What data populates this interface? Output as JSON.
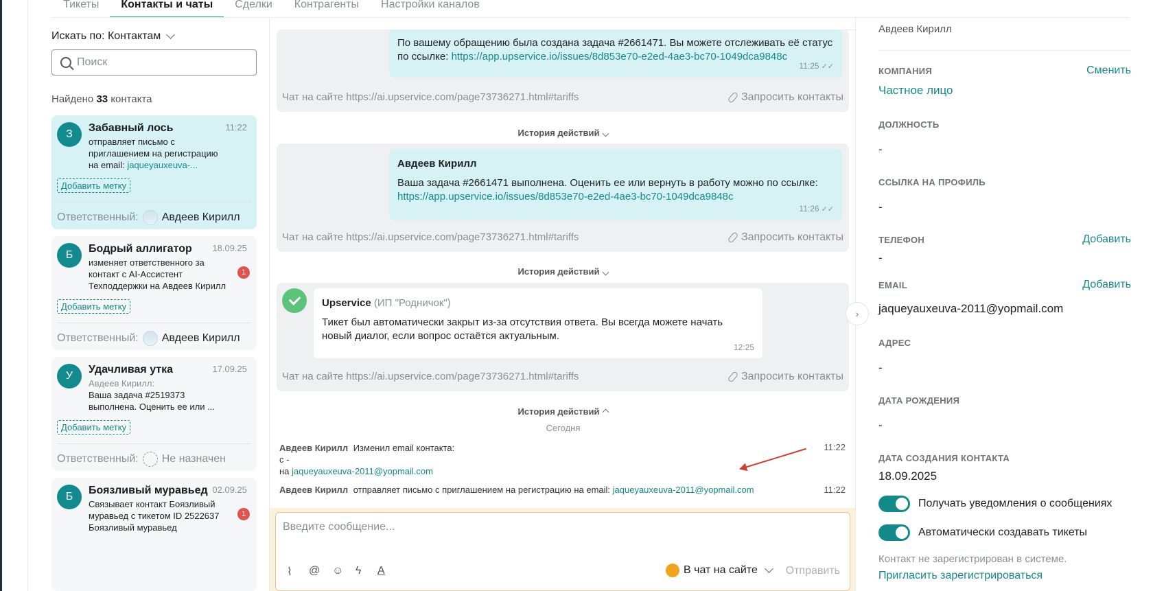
{
  "tabs": [
    "Тикеты",
    "Контакты и чаты",
    "Сделки",
    "Контрагенты",
    "Настройки каналов"
  ],
  "left": {
    "search_by": "Искать по: Контактам",
    "search_placeholder": "Поиск",
    "found_prefix": "Найдено",
    "found_count": "33",
    "found_suffix": "контакта",
    "add_tag_label": "Добавить метку",
    "responsible_label": "Ответственный:",
    "contacts": [
      {
        "initial": "З",
        "name": "Забавный лось",
        "time": "11:22",
        "text": "отправляет письмо с приглашением на регистрацию на email:",
        "link": "jaqueyauxeuva-...",
        "responsible": "Авдеев Кирилл"
      },
      {
        "initial": "Б",
        "name": "Бодрый аллигатор",
        "time": "18.09.25",
        "text": "изменяет ответственного за контакт с AI-Ассистент Техподдержки на Авдеев Кирилл",
        "badge": "1",
        "responsible": "Авдеев Кирилл"
      },
      {
        "initial": "У",
        "name": "Удачливая утка",
        "time": "17.09.25",
        "sender": "Авдеев Кирилл:",
        "text": "Ваша задача #2519373 выполнена. Оценить ее или ...",
        "responsible": "Не назначен"
      },
      {
        "initial": "Б",
        "name": "Боязливый муравьед",
        "time": "02.09.25",
        "text": "Связывает контакт Боязливый муравьед с тикетом ID 2522637 Боязливый муравьед",
        "badge": "1"
      }
    ]
  },
  "chat": {
    "channel": "Чат на сайте https://ai.upservice.com/page73736271.html#tariffs",
    "request_contacts": "Запросить контакты",
    "history_label": "История действий",
    "msg1": {
      "text": "По вашему обращению была создана задача #2661471. Вы можете отслеживать её статус по ссылке:",
      "link": "https://app.upservice.io/issues/8d853e70-e2ed-4ae3-bc70-1049dca9848c",
      "time": "11:25"
    },
    "msg2": {
      "author": "Авдеев Кирилл",
      "text": "Ваша задача #2661471 выполнена. Оценить ее или вернуть в работу можно по ссылке:",
      "link": "https://app.upservice.io/issues/8d853e70-e2ed-4ae3-bc70-1049dca9848c",
      "time": "11:26"
    },
    "msg3": {
      "author": "Upservice",
      "org": "(ИП \"Родничок\")",
      "text": "Тикет был автоматически закрыт из-за отсутствия ответа. Вы всегда можете начать новый диалог, если вопрос остаётся актуальным.",
      "time": "12:25"
    },
    "today": "Сегодня",
    "log1": {
      "author": "Авдеев Кирилл",
      "action": "Изменил email контакта:",
      "from": "с -",
      "to_prefix": "на",
      "to": "jaqueyauxeuva-2011@yopmail.com",
      "time": "11:22"
    },
    "log2": {
      "author": "Авдеев Кирилл",
      "action": "отправляет письмо с приглашением на регистрацию на email:",
      "email": "jaqueyauxeuva-2011@yopmail.com",
      "time": "11:22"
    },
    "composer_placeholder": "Введите сообщение...",
    "channel_select": "В чат на сайте",
    "send": "Отправить"
  },
  "right": {
    "owner": "Авдеев Кирилл",
    "company_label": "КОМПАНИЯ",
    "company_action": "Сменить",
    "company_value": "Частное лицо",
    "position_label": "ДОЛЖНОСТЬ",
    "position_value": "-",
    "profile_label": "ССЫЛКА НА ПРОФИЛЬ",
    "profile_value": "-",
    "phone_label": "ТЕЛЕФОН",
    "phone_action": "Добавить",
    "phone_value": "-",
    "email_label": "EMAIL",
    "email_action": "Добавить",
    "email_value": "jaqueyauxeuva-2011@yopmail.com",
    "address_label": "АДРЕС",
    "address_value": "-",
    "birthday_label": "ДАТА РОЖДЕНИЯ",
    "birthday_value": "-",
    "created_label": "ДАТА СОЗДАНИЯ КОНТАКТА",
    "created_value": "18.09.2025",
    "toggle1": "Получать уведомления о сообщениях",
    "toggle2": "Автоматически создавать тикеты",
    "not_registered": "Контакт не зарегистрирован в системе.",
    "invite": "Пригласить зарегистрироваться"
  }
}
